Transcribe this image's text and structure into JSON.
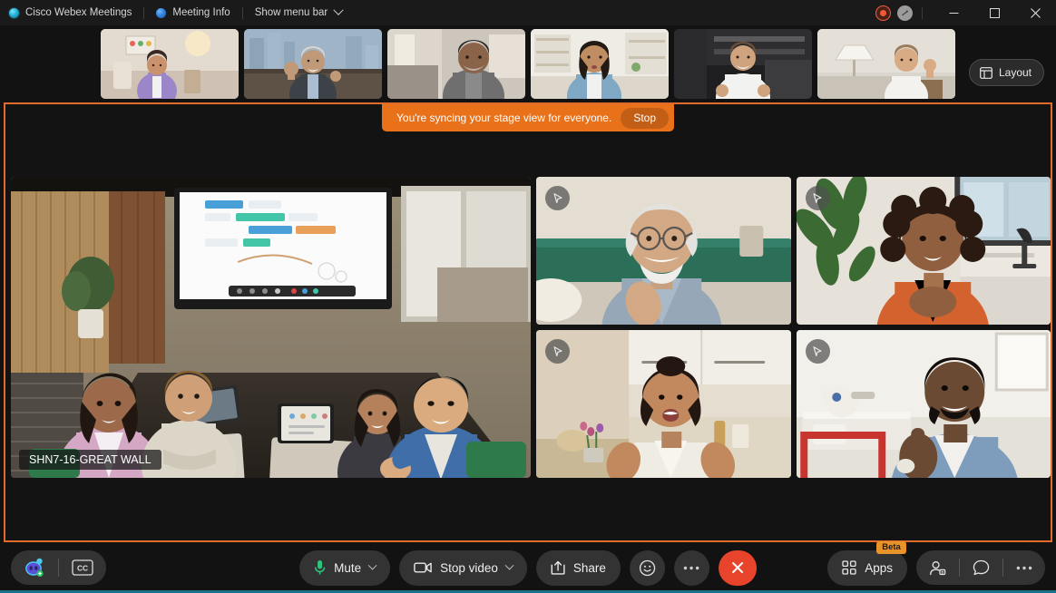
{
  "titlebar": {
    "app_name": "Cisco Webex Meetings",
    "meeting_info": "Meeting Info",
    "show_menu_bar": "Show menu bar",
    "recording_indicator": "recording-indicator",
    "connection_indicator": "connection-indicator",
    "minimize": "Minimize",
    "maximize": "Maximize",
    "close": "Close"
  },
  "filmstrip": {
    "layout_label": "Layout",
    "thumbnails": [
      {
        "name": "participant-thumb-1",
        "alt": "Woman in purple shirt in living room"
      },
      {
        "name": "participant-thumb-2",
        "alt": "Man waving in city-view office"
      },
      {
        "name": "participant-thumb-3",
        "alt": "Man in gray sweater at home"
      },
      {
        "name": "participant-thumb-4",
        "alt": "Woman in blue shirt with bookshelf"
      },
      {
        "name": "participant-thumb-5",
        "alt": "Man in white shirt in dark office"
      },
      {
        "name": "participant-thumb-6",
        "alt": "Woman waving near floor lamp"
      }
    ]
  },
  "stage": {
    "banner_text": "You're syncing your stage view for everyone.",
    "stop_label": "Stop",
    "border_color": "#e06b2a",
    "banner_color": "#e8711a",
    "main_tile": {
      "name": "main-video-tile",
      "label": "SHN7-16-GREAT WALL",
      "alt": "Conference room with five people at a table and a digital whiteboard"
    },
    "participants": [
      {
        "name": "participant-tile-1",
        "alt": "Older man with white beard on green couch",
        "pin": "stage-pin-icon"
      },
      {
        "name": "participant-tile-2",
        "alt": "Woman in orange top with plant and window",
        "pin": "stage-pin-icon"
      },
      {
        "name": "participant-tile-3",
        "alt": "Woman in cream blouse in kitchen",
        "pin": "stage-pin-icon"
      },
      {
        "name": "participant-tile-4",
        "alt": "Man in denim shirt giving thumbs up",
        "pin": "stage-pin-icon"
      }
    ]
  },
  "toolbar": {
    "assistant_label": "Webex Assistant",
    "captions_label": "CC",
    "mute_label": "Mute",
    "stop_video_label": "Stop video",
    "share_label": "Share",
    "reactions_label": "Reactions",
    "more_label": "More options",
    "end_label": "End meeting",
    "apps_label": "Apps",
    "apps_badge": "Beta",
    "participants_label": "Participants",
    "chat_label": "Chat",
    "right_more_label": "More",
    "accent_color": "#1b6f86",
    "end_color": "#e8442c",
    "mic_color": "#2fc47c"
  }
}
